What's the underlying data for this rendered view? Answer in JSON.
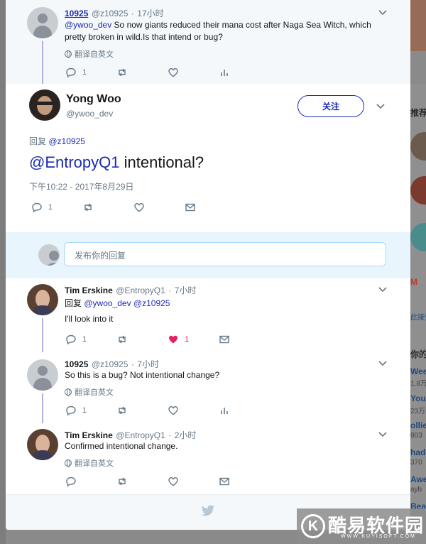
{
  "background": {
    "right_items": [
      {
        "text": "推荐"
      },
      {
        "text": "M"
      },
      {
        "text": "此接受"
      },
      {
        "text": "你的"
      },
      {
        "text": "Wee"
      },
      {
        "text": "1.8万"
      },
      {
        "text": "You"
      },
      {
        "text": "23万"
      },
      {
        "text": "ollie"
      },
      {
        "text": "803"
      },
      {
        "text": "hade"
      },
      {
        "text": "370"
      },
      {
        "text": "Awe"
      },
      {
        "text": "ayb"
      },
      {
        "text": "Bea"
      }
    ]
  },
  "parent_tweet": {
    "name": "10925",
    "handle": "@z10925",
    "time": "17小时",
    "mention": "@ywoo_dev",
    "text_after_mention": " So now giants reduced their mana cost after Naga Sea Witch, which pretty broken in wild.Is that intend or bug?",
    "translate": "翻译自英文",
    "reply_count": "1",
    "retweet_count": "",
    "like_count": ""
  },
  "main_tweet": {
    "name": "Yong Woo",
    "handle": "@ywoo_dev",
    "follow_label": "关注",
    "reply_to_label": "回复",
    "reply_to_handle": "@z10925",
    "mention": "@EntropyQ1",
    "text_after_mention": " intentional?",
    "timestamp": "下午10:22 - 2017年8月29日",
    "reply_count": "1"
  },
  "reply_box": {
    "placeholder": "发布你的回复"
  },
  "replies": [
    {
      "name": "Tim Erskine",
      "handle": "@EntropyQ1",
      "time": "7小时",
      "reply_to_label": "回复",
      "reply_to_handles": "@ywoo_dev @z10925",
      "text": "I'll look into it",
      "reply_count": "1",
      "like_count": "1"
    },
    {
      "name": "10925",
      "handle": "@z10925",
      "time": "7小时",
      "text": "So this is a bug? Not intentional change?",
      "translate": "翻译自英文",
      "reply_count": "1"
    },
    {
      "name": "Tim Erskine",
      "handle": "@EntropyQ1",
      "time": "2小时",
      "text": "Confirmed intentional change.",
      "translate": "翻译自英文"
    }
  ],
  "separator": "·",
  "watermark": {
    "text": "酷易软件园",
    "url": "WWW.KUYISOFT.COM",
    "letter": "K"
  },
  "colors": {
    "link": "#1b2ab5",
    "like_active": "#e0245e",
    "thread_line": "#b4b0e4",
    "reply_area": "#e8f5fd"
  }
}
